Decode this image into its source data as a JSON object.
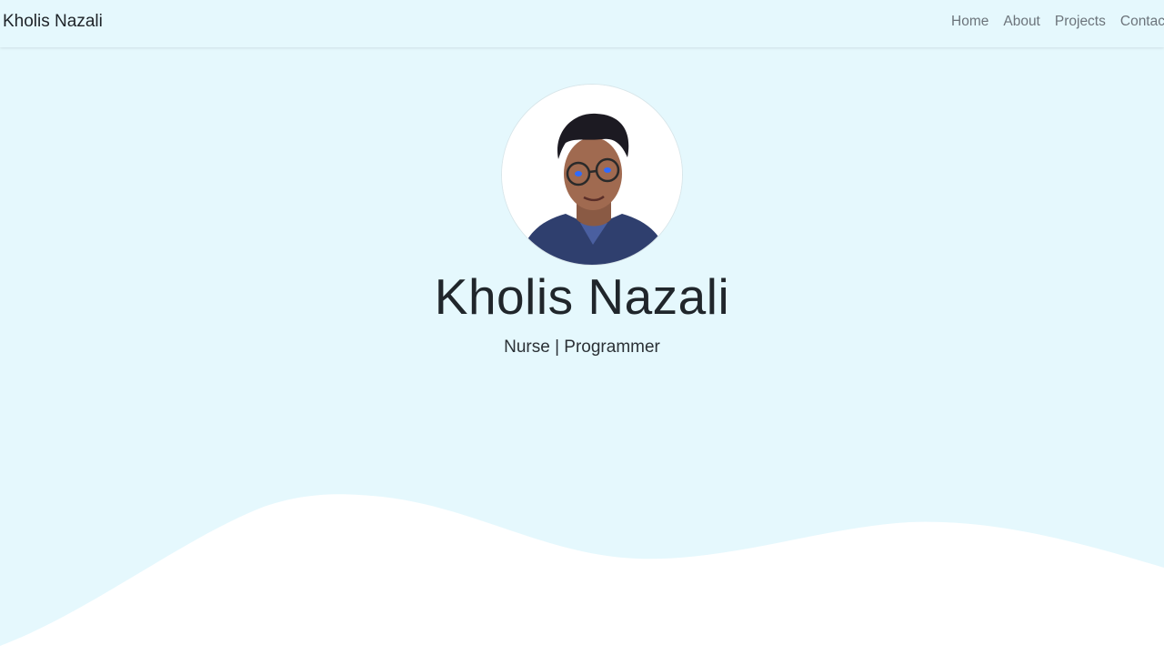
{
  "navbar": {
    "brand": "Kholis Nazali",
    "links": [
      "Home",
      "About",
      "Projects",
      "Contact"
    ]
  },
  "hero": {
    "name": "Kholis Nazali",
    "subtitle": "Nurse | Programmer"
  },
  "colors": {
    "background": "#e5f8fd",
    "wave": "#ffffff",
    "text": "#20262b",
    "nav_link": "#6c747b"
  }
}
